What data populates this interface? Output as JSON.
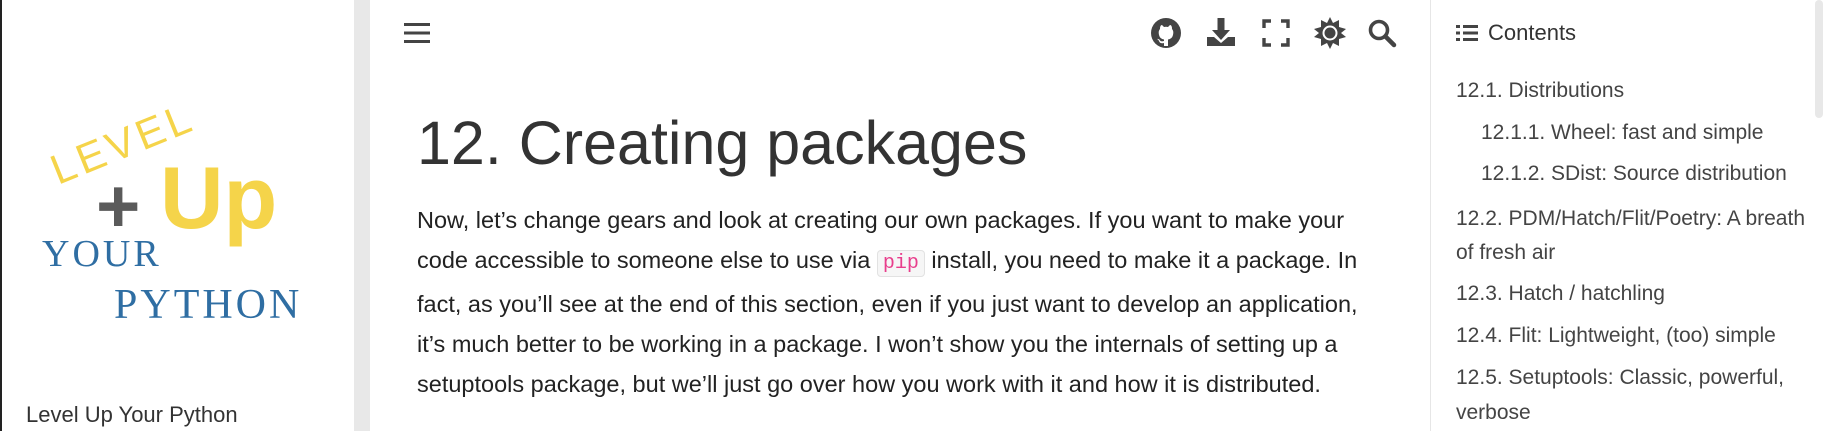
{
  "sidebar": {
    "logo": {
      "line1": "LEVEL",
      "line2_plus": "+",
      "line2_up": "Up",
      "line3": "YOUR",
      "line4": "PYTHON"
    },
    "site_title": "Level Up Your Python"
  },
  "topbar": {
    "icons": [
      "menu-icon",
      "github-icon",
      "download-icon",
      "fullscreen-icon",
      "theme-icon",
      "search-icon"
    ]
  },
  "main": {
    "title": "12. Creating packages",
    "para_before": "Now, let’s change gears and look at creating our own packages. If you want to make your code accessible to someone else to use via ",
    "para_code": "pip",
    "para_after": " install, you need to make it a package. In fact, as you’ll see at the end of this section, even if you just want to develop an application, it’s much better to be working in a package. I won’t show you the internals of setting up a setuptools package, but we’ll just go over how you work with it and how it is distributed."
  },
  "toc": {
    "header": "Contents",
    "items": [
      {
        "label": "12.1. Distributions"
      },
      {
        "label": "12.1.1. Wheel: fast and simple"
      },
      {
        "label": "12.1.2. SDist: Source distribution"
      },
      {
        "label": "12.2. PDM/Hatch/Flit/Poetry: A breath"
      },
      {
        "label": "of fresh air"
      },
      {
        "label": "12.3. Hatch / hatchling"
      },
      {
        "label": "12.4. Flit: Lightweight, (too) simple"
      },
      {
        "label": "12.5. Setuptools: Classic, powerful,"
      },
      {
        "label": "verbose"
      }
    ]
  },
  "colors": {
    "logo_yellow": "#f5d44a",
    "logo_blue": "#2f6ea3",
    "logo_gray": "#5a5a5a",
    "code_pink": "#e83e8c"
  }
}
